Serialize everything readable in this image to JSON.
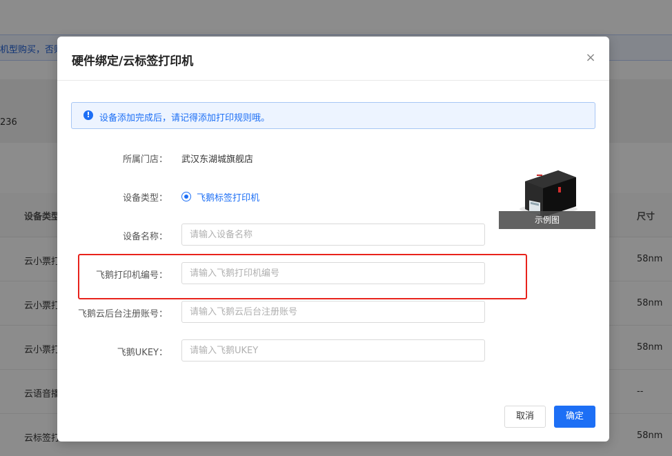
{
  "background": {
    "notice_text": "机型购买，否则",
    "summary_number": "236",
    "table": {
      "header_left": "设备类型",
      "header_right": "尺寸",
      "rows": [
        {
          "left": "云小票打",
          "right": "58nm"
        },
        {
          "left": "云小票打",
          "right": "58nm"
        },
        {
          "left": "云小票打",
          "right": "58nm"
        },
        {
          "left": "云语音播",
          "right": "--"
        },
        {
          "left": "云标签打",
          "right": "58nm"
        }
      ]
    }
  },
  "modal": {
    "title": "硬件绑定/云标签打印机",
    "close_glyph": "×",
    "alert": {
      "icon_glyph": "!",
      "text": "设备添加完成后，请记得添加打印规则哦。"
    },
    "fields": {
      "store": {
        "label": "所属门店：",
        "value": "武汉东湖城旗舰店"
      },
      "device_type": {
        "label": "设备类型：",
        "option": "飞鹅标签打印机"
      },
      "device_name": {
        "label": "设备名称：",
        "placeholder": "请输入设备名称"
      },
      "printer_sn": {
        "label": "飞鹅打印机编号：",
        "placeholder": "请输入飞鹅打印机编号"
      },
      "cloud_account": {
        "label": "飞鹅云后台注册账号：",
        "placeholder": "请输入飞鹅云后台注册账号"
      },
      "ukey": {
        "label": "飞鹅UKEY：",
        "placeholder": "请输入飞鹅UKEY"
      }
    },
    "example_caption": "示例图",
    "buttons": {
      "cancel": "取消",
      "ok": "确定"
    },
    "colors": {
      "primary": "#1d6ff5",
      "highlight": "#e8221b"
    }
  }
}
